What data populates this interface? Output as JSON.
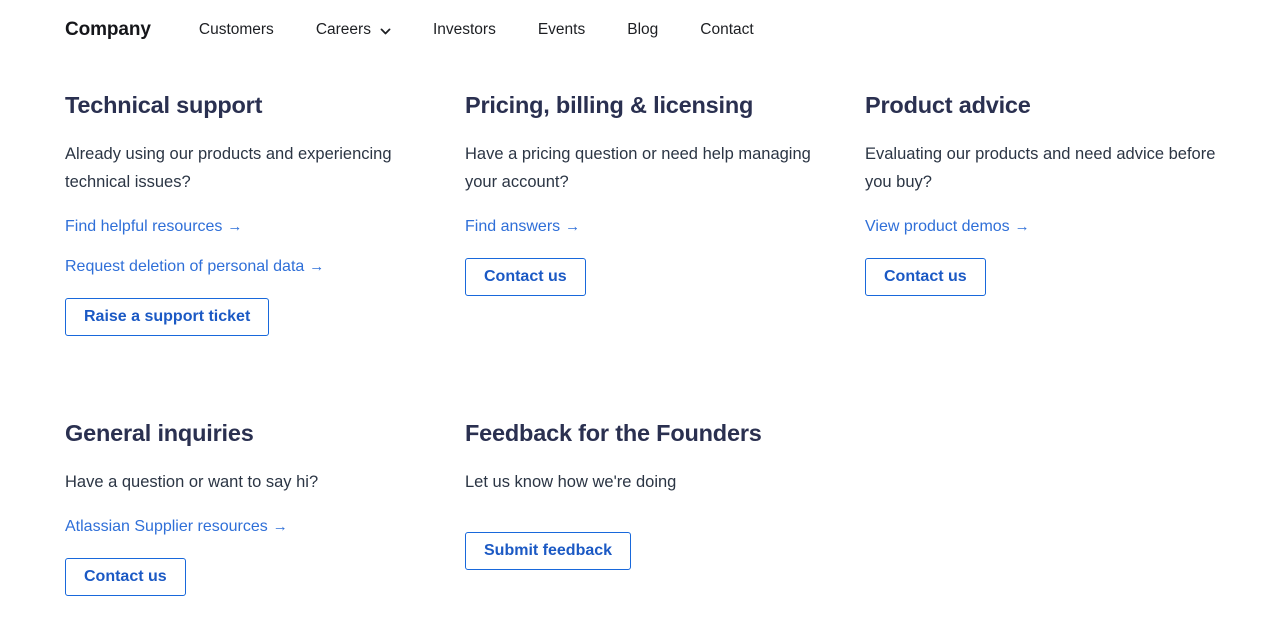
{
  "header": {
    "brand": "Company",
    "nav": [
      {
        "label": "Customers",
        "has_dropdown": false
      },
      {
        "label": "Careers",
        "has_dropdown": true,
        "icon": "chevron-down-icon"
      },
      {
        "label": "Investors",
        "has_dropdown": false
      },
      {
        "label": "Events",
        "has_dropdown": false
      },
      {
        "label": "Blog",
        "has_dropdown": false
      },
      {
        "label": "Contact",
        "has_dropdown": false
      }
    ]
  },
  "colors": {
    "heading": "#2a3050",
    "body_text": "#2b3544",
    "link": "#2f6fd8",
    "button_border": "#1868db",
    "button_text": "#1b59c4",
    "brand_text": "#15161a",
    "background": "#ffffff"
  },
  "cards": [
    {
      "title": "Technical support",
      "description": "Already using our products and experiencing technical issues?",
      "links": [
        {
          "label": "Find helpful resources",
          "arrow": "→"
        },
        {
          "label": "Request deletion of personal data",
          "arrow": "→"
        }
      ],
      "button": "Raise a support ticket"
    },
    {
      "title": "Pricing, billing & licensing",
      "description": "Have a pricing question or need help managing your account?",
      "links": [
        {
          "label": "Find answers",
          "arrow": "→"
        }
      ],
      "button": "Contact us"
    },
    {
      "title": "Product advice",
      "description": "Evaluating our products and need advice before you buy?",
      "links": [
        {
          "label": "View product demos",
          "arrow": "→"
        }
      ],
      "button": "Contact us"
    },
    {
      "title": "General inquiries",
      "description": "Have a question or want to say hi?",
      "links": [
        {
          "label": "Atlassian Supplier resources",
          "arrow": "→"
        }
      ],
      "button": "Contact us"
    },
    {
      "title": "Feedback for the Founders",
      "description": "Let us know how we're doing",
      "links": [],
      "button": "Submit feedback"
    }
  ]
}
